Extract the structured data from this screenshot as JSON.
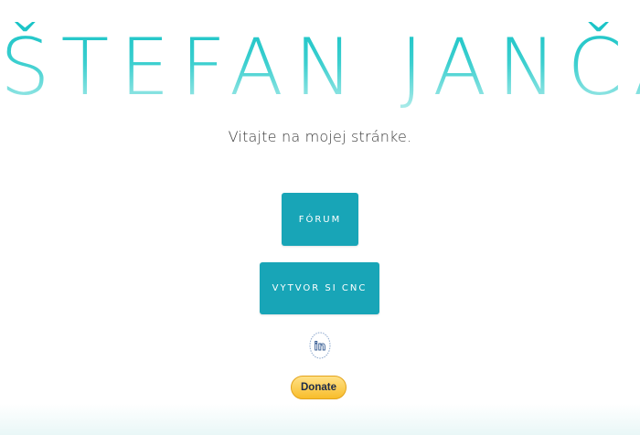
{
  "header": {
    "title": "ŠTEFAN JANČÁR"
  },
  "main": {
    "welcome_text": "Vitajte na mojej stránke.",
    "buttons": {
      "forum_label": "FÓRUM",
      "cnc_label": "VYTVOR SI CNC"
    },
    "social": {
      "linkedin_label": "in"
    },
    "donate": {
      "label": "Donate"
    }
  },
  "colors": {
    "accent": "#18a5b7",
    "title_gradient_top": "#18c3c6",
    "title_gradient_bottom": "#b8eeec",
    "donate_yellow": "#f8bd2b"
  },
  "icons": {
    "linkedin": "linkedin-icon"
  }
}
